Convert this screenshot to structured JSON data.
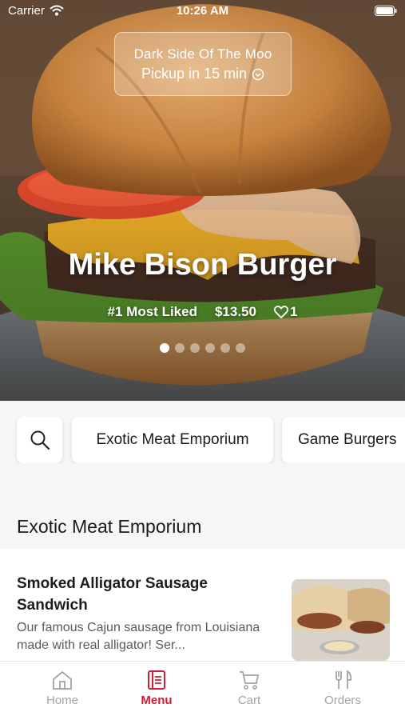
{
  "status_bar": {
    "carrier": "Carrier",
    "time": "10:26 AM"
  },
  "pickup": {
    "store_name": "Dark Side Of The Moo",
    "eta": "Pickup in 15 min"
  },
  "hero": {
    "title": "Mike Bison Burger",
    "badge": "#1 Most Liked",
    "price": "$13.50",
    "likes": "1",
    "slide_count": 6,
    "active_slide": 0
  },
  "categories": {
    "items": [
      "Exotic Meat Emporium",
      "Game Burgers"
    ]
  },
  "section": {
    "title": "Exotic Meat Emporium"
  },
  "menu_item": {
    "name": "Smoked Alligator Sausage Sandwich",
    "description": "Our famous Cajun sausage from Louisiana made with real alligator! Ser..."
  },
  "tabs": [
    {
      "label": "Home",
      "icon": "home-icon",
      "active": false
    },
    {
      "label": "Menu",
      "icon": "menu-icon",
      "active": true
    },
    {
      "label": "Cart",
      "icon": "cart-icon",
      "active": false
    },
    {
      "label": "Orders",
      "icon": "orders-icon",
      "active": false
    }
  ],
  "colors": {
    "accent": "#d31c35",
    "inactive_tab": "#a3a3a3",
    "background": "#f6f6f6"
  }
}
